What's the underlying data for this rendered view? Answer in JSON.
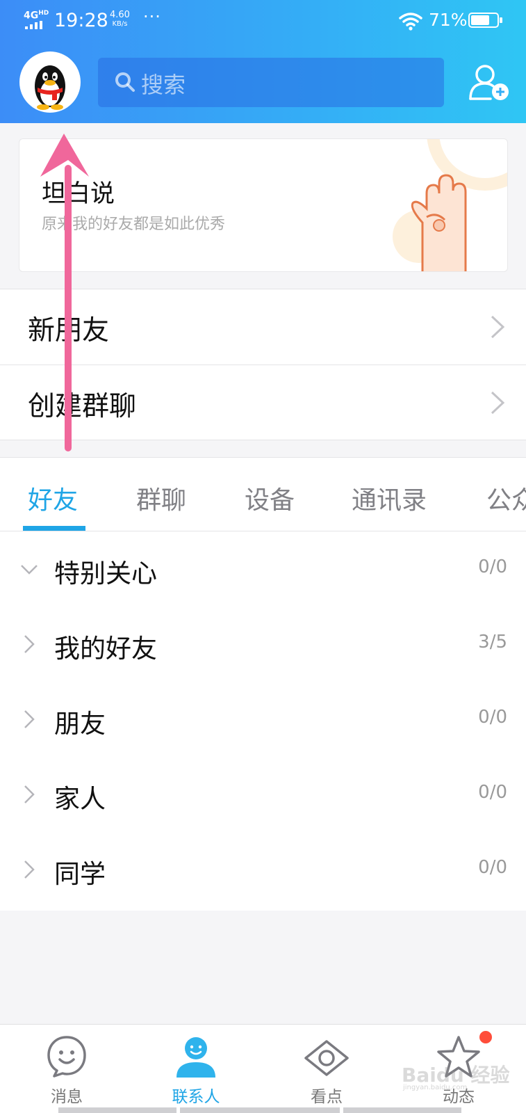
{
  "status_bar": {
    "network": "4G",
    "network_suffix": "HD",
    "time": "19:28",
    "speed_value": "4.60",
    "speed_unit": "KB/s",
    "dots": "···",
    "battery_pct_text": "71%",
    "battery_level": 0.71
  },
  "header": {
    "search_placeholder": "搜索"
  },
  "banner": {
    "title": "坦白说",
    "subtitle": "原来我的好友都是如此优秀"
  },
  "menu": {
    "items": [
      {
        "label": "新朋友"
      },
      {
        "label": "创建群聊"
      }
    ]
  },
  "tabs": {
    "items": [
      {
        "label": "好友",
        "active": true
      },
      {
        "label": "群聊",
        "active": false
      },
      {
        "label": "设备",
        "active": false
      },
      {
        "label": "通讯录",
        "active": false
      },
      {
        "label": "公众号",
        "active": false
      }
    ]
  },
  "groups": {
    "items": [
      {
        "name": "特别关心",
        "count": "0/0",
        "expanded": true
      },
      {
        "name": "我的好友",
        "count": "3/5",
        "expanded": false
      },
      {
        "name": "朋友",
        "count": "0/0",
        "expanded": false
      },
      {
        "name": "家人",
        "count": "0/0",
        "expanded": false
      },
      {
        "name": "同学",
        "count": "0/0",
        "expanded": false
      }
    ]
  },
  "bottom_nav": {
    "items": [
      {
        "label": "消息",
        "icon": "smile-chat-icon",
        "active": false
      },
      {
        "label": "联系人",
        "icon": "person-icon",
        "active": true
      },
      {
        "label": "看点",
        "icon": "eye-icon",
        "active": false
      },
      {
        "label": "动态",
        "icon": "star-icon",
        "active": false,
        "badge": true
      }
    ]
  },
  "watermark": {
    "text": "Baidu 经验",
    "sub": "jingyan.baidu.com"
  },
  "colors": {
    "accent": "#1fa5e6",
    "header_start": "#3c8df7",
    "header_end": "#2fc6f4",
    "annotation": "#f0679b",
    "badge": "#ff4d3a"
  }
}
